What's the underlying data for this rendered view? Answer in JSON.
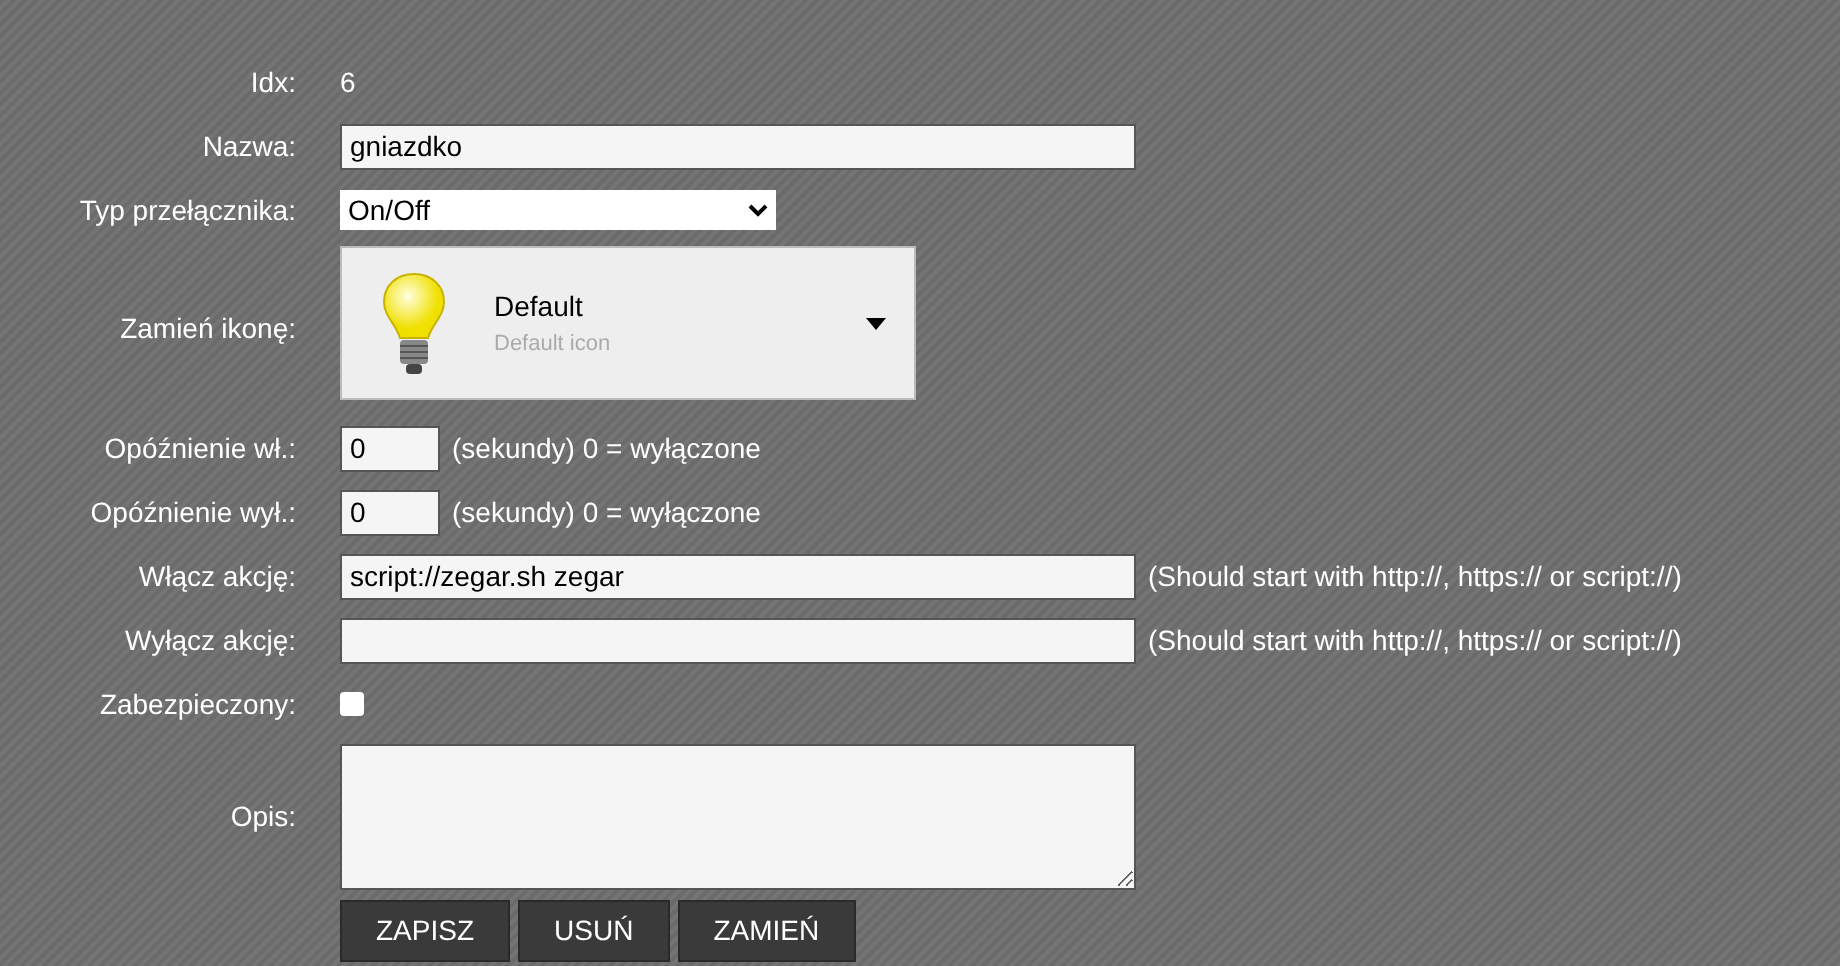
{
  "fields": [
    {
      "kind": "static",
      "label": "Idx:",
      "value": "6"
    },
    {
      "kind": "text",
      "label": "Nazwa:",
      "value": "gniazdko"
    },
    {
      "kind": "select",
      "label": "Typ przełącznika:",
      "value": "On/Off"
    },
    {
      "kind": "iconpicker",
      "label": "Zamień ikonę:",
      "title": "Default",
      "subtitle": "Default icon"
    },
    {
      "kind": "short",
      "label": "Opóźnienie wł.:",
      "value": "0",
      "hint": "(sekundy) 0 = wyłączone"
    },
    {
      "kind": "short",
      "label": "Opóźnienie wył.:",
      "value": "0",
      "hint": "(sekundy) 0 = wyłączone"
    },
    {
      "kind": "text",
      "label": "Włącz akcję:",
      "value": "script://zegar.sh zegar",
      "hint": "(Should start with http://, https:// or script://)"
    },
    {
      "kind": "text",
      "label": "Wyłącz akcję:",
      "hint": "(Should start with http://, https:// or script://)"
    },
    {
      "kind": "checkbox",
      "label": "Zabezpieczony:",
      "checked": false
    },
    {
      "kind": "textarea",
      "label": "Opis:"
    }
  ],
  "buttons": [
    "ZAPISZ",
    "USUŃ",
    "ZAMIEŃ"
  ]
}
